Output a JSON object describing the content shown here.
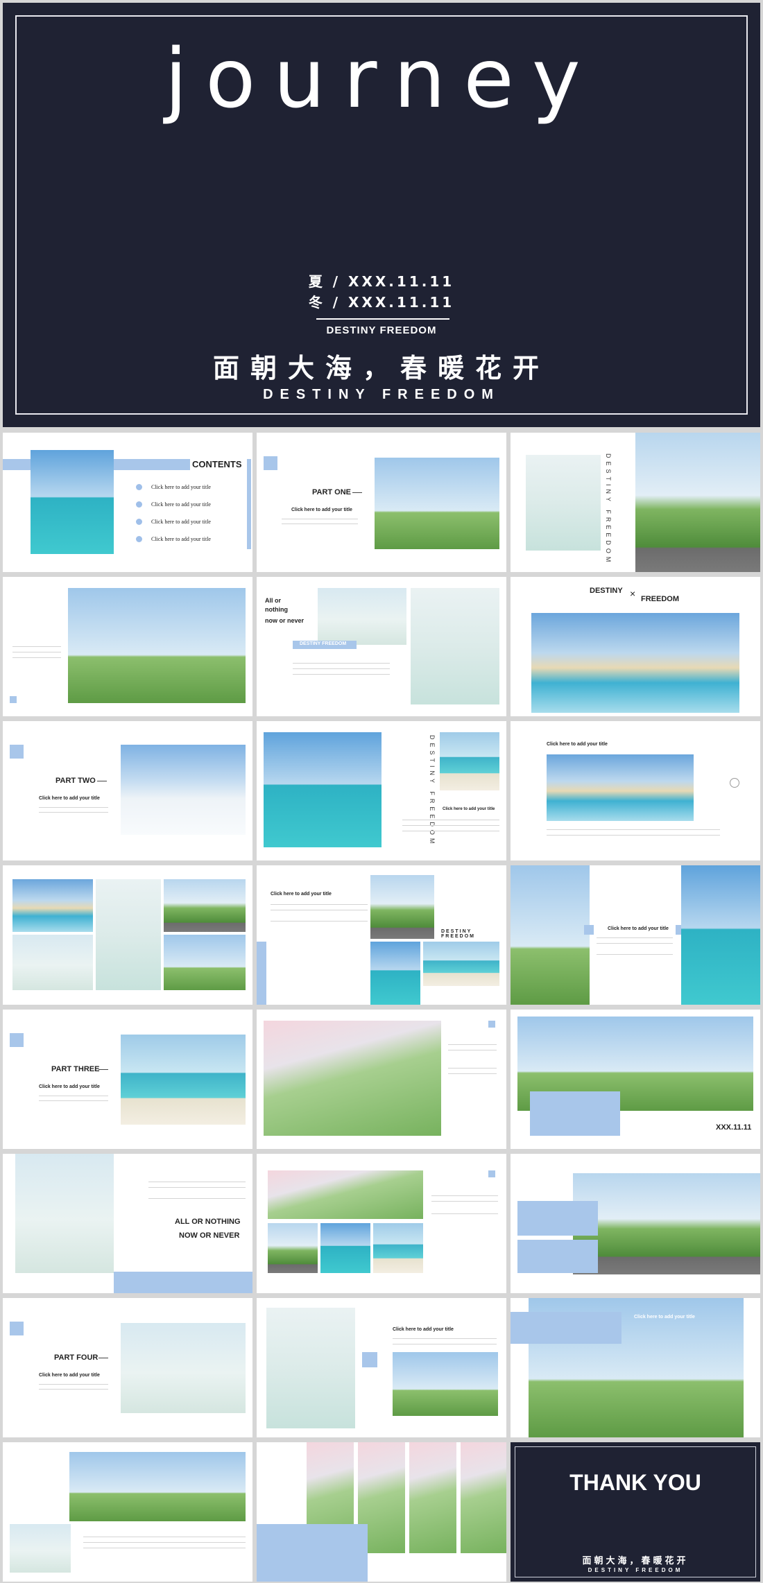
{
  "hero": {
    "title": "journey",
    "season_summer": "夏 / XXX.11.11",
    "season_winter": "冬 / XXX.11.11",
    "subtitle": "DESTINY FREEDOM",
    "cn_slogan": "面朝大海，春暖花开",
    "en_slogan": "DESTINY FREEDOM"
  },
  "contents": {
    "heading": "CONTENTS",
    "items": [
      "Click here to add your title",
      "Click here to add your title",
      "Click here to add your title",
      "Click here to add your title"
    ]
  },
  "parts": {
    "one": "PART ONE",
    "two": "PART TWO",
    "three": "PART THREE",
    "four": "PART FOUR"
  },
  "common": {
    "click_title": "Click here to add your title",
    "destiny_freedom": "DESTINY FREEDOM",
    "destiny": "DESTINY",
    "freedom": "FREEDOM",
    "destiny_x": "×"
  },
  "slide4": {
    "all": "All or",
    "nothing": "nothing",
    "now_never": "now or never",
    "tag": "DESTINY FREEDOM"
  },
  "slide15": {
    "date": "XXX.11.11"
  },
  "slide16": {
    "line1": "ALL OR NOTHING",
    "line2": "NOW OR NEVER"
  },
  "thanks": {
    "title": "THANK YOU",
    "cn": "面朝大海，春暖花开",
    "en": "DESTINY FREEDOM"
  },
  "colors": {
    "accent": "#a8c6ea",
    "dark": "#1f2233"
  }
}
